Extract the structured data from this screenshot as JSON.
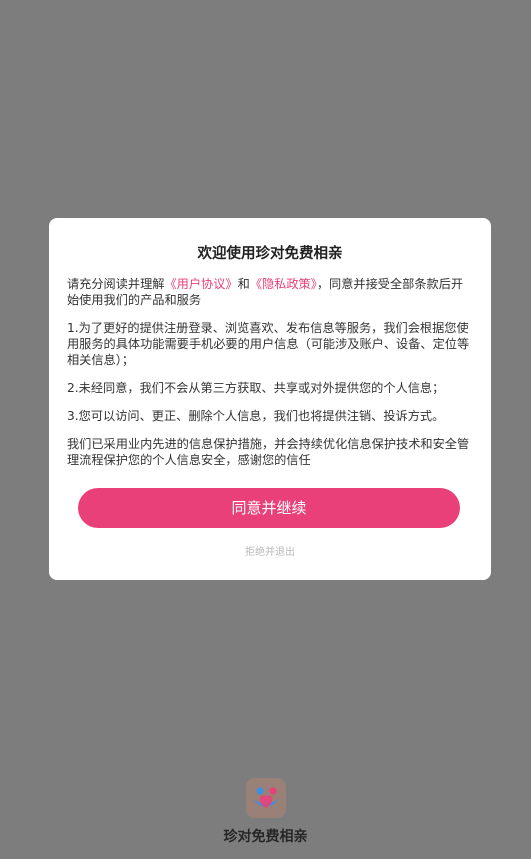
{
  "splash": {
    "app_name": "珍对免费相亲",
    "logo": {
      "icon": "app-logo-icon",
      "bg_color": "#9a8178"
    }
  },
  "dialog": {
    "title": "欢迎使用珍对免费相亲",
    "intro": {
      "prefix": "请充分阅读并理解",
      "user_agreement_link": "《用户协议》",
      "and": "和",
      "privacy_policy_link": "《隐私政策》",
      "suffix": "，同意并接受全部条款后开始使用我们的产品和服务"
    },
    "items": [
      "1.为了更好的提供注册登录、浏览喜欢、发布信息等服务，我们会根据您使用服务的具体功能需要手机必要的用户信息（可能涉及账户、设备、定位等相关信息）；",
      "2.未经同意，我们不会从第三方获取、共享或对外提供您的个人信息；",
      "3.您可以访问、更正、删除个人信息，我们也将提供注销、投诉方式。"
    ],
    "closing": "我们已采用业内先进的信息保护措施，并会持续优化信息保护技术和安全管理流程保护您的个人信息安全，感谢您的信任",
    "agree_button": "同意并继续",
    "decline_link": "拒绝并退出",
    "accent_color": "#e9407a"
  }
}
